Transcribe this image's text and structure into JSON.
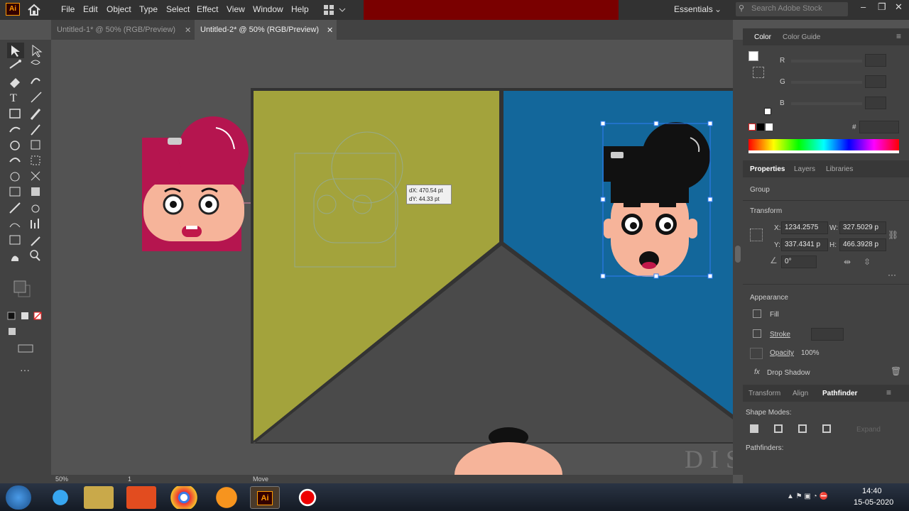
{
  "app": {
    "logo": "Ai",
    "workspace": "Essentials",
    "search_placeholder": "Search Adobe Stock"
  },
  "menu": [
    "File",
    "Edit",
    "Object",
    "Type",
    "Select",
    "Effect",
    "View",
    "Window",
    "Help"
  ],
  "tabs": [
    {
      "label": "Untitled-1* @ 50% (RGB/Preview)",
      "active": false
    },
    {
      "label": "Untitled-2* @ 50% (RGB/Preview)",
      "active": true
    }
  ],
  "canvas": {
    "tooltip_dx": "dX: 470.54 pt",
    "tooltip_dy": "dY: 44.33 pt"
  },
  "color_panel": {
    "tab_color": "Color",
    "tab_guide": "Color Guide",
    "r": "R",
    "g": "G",
    "b": "B",
    "hash": "#"
  },
  "properties_panel": {
    "tab_properties": "Properties",
    "tab_layers": "Layers",
    "tab_libraries": "Libraries",
    "group_label": "Group",
    "transform_label": "Transform",
    "x_label": "X:",
    "x_value": "1234.2575",
    "y_label": "Y:",
    "y_value": "337.4341 p",
    "w_label": "W:",
    "w_value": "327.5029 p",
    "h_label": "H:",
    "h_value": "466.3928 p",
    "angle_value": "0°",
    "appearance_label": "Appearance",
    "fill_label": "Fill",
    "stroke_label": "Stroke",
    "opacity_label": "Opacity",
    "opacity_value": "100%",
    "drop_shadow": "Drop Shadow"
  },
  "pathfinder_panel": {
    "tab_transform": "Transform",
    "tab_align": "Align",
    "tab_pathfinder": "Pathfinder",
    "shape_modes": "Shape Modes:",
    "expand": "Expand",
    "pathfinders": "Pathfinders:"
  },
  "status": {
    "zoom": "50%",
    "page": "1",
    "tool": "Move"
  },
  "watermark": "DISHANKK",
  "clock": {
    "time": "14:40",
    "date": "15-05-2020"
  },
  "colors": {
    "olive": "#a3a33c",
    "blue": "#13679b",
    "dark": "#4a4a4a",
    "pink": "#b5154f",
    "skin": "#f6b49a",
    "accent": "#ff9a00"
  },
  "icons": [
    "home-icon",
    "search-icon",
    "selection-tool-icon",
    "direct-selection-tool-icon",
    "pen-tool-icon",
    "type-tool-icon",
    "rectangle-tool-icon",
    "hand-tool-icon",
    "zoom-tool-icon"
  ]
}
